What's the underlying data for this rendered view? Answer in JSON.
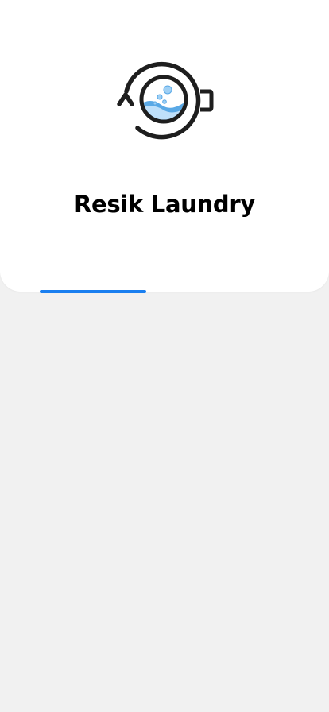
{
  "app": {
    "title": "Resik Laundry",
    "logo_icon": "washing-machine-icon"
  },
  "colors": {
    "accent": "#1a7ff0",
    "background": "#f1f1f1",
    "card": "#ffffff",
    "logo_stroke": "#1e1e1e",
    "logo_water": "#5aa9e6",
    "logo_water_light": "#bfe0fa"
  },
  "tabs": {
    "active_index": 0
  }
}
